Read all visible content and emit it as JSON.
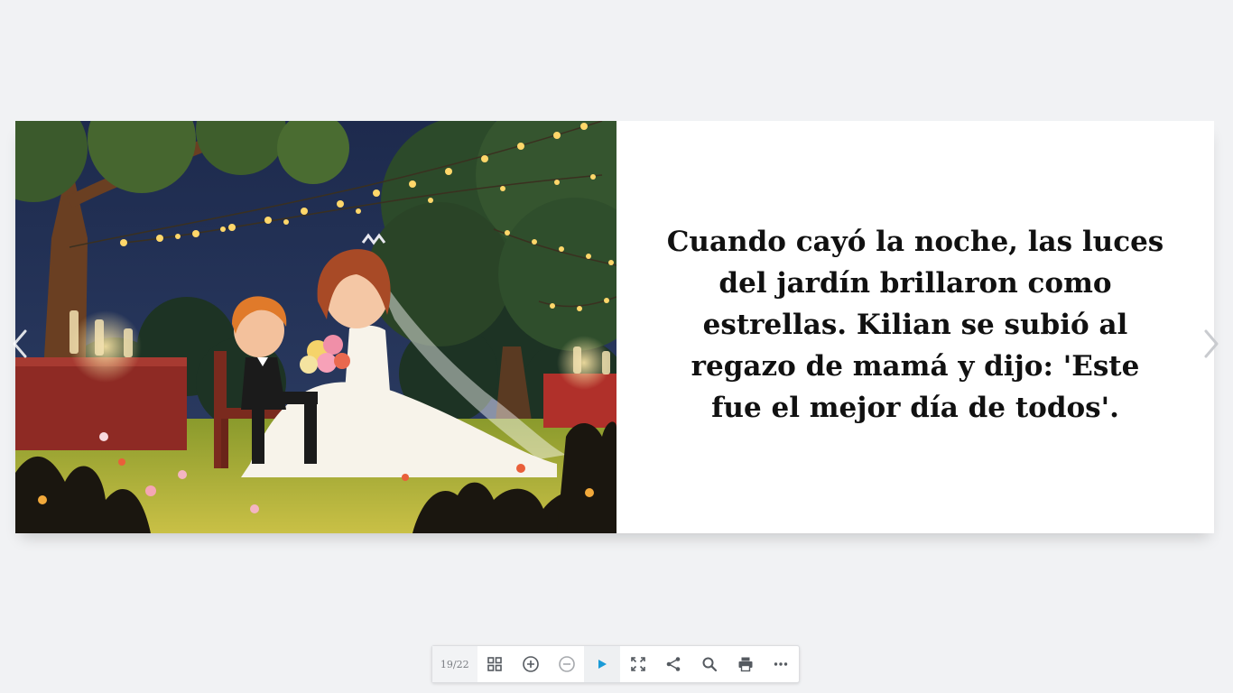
{
  "book": {
    "story_text": "Cuando cayó la noche, las luces del jardín brillaron como estrellas. Kilian se subió al regazo de mamá y dijo: 'Este fue el mejor día de todos'."
  },
  "navigation": {
    "prev_icon": "chevron-left-icon",
    "next_icon": "chevron-right-icon"
  },
  "toolbar": {
    "page_counter": "19/22",
    "buttons": [
      {
        "icon": "grid-icon"
      },
      {
        "icon": "zoom-in-icon"
      },
      {
        "icon": "zoom-out-icon"
      },
      {
        "icon": "play-icon"
      },
      {
        "icon": "fullscreen-icon"
      },
      {
        "icon": "share-icon"
      },
      {
        "icon": "search-icon"
      },
      {
        "icon": "print-icon"
      },
      {
        "icon": "more-icon"
      }
    ]
  },
  "colors": {
    "background": "#f1f2f4",
    "accent": "#1a9bd7",
    "icon": "#555a60"
  }
}
